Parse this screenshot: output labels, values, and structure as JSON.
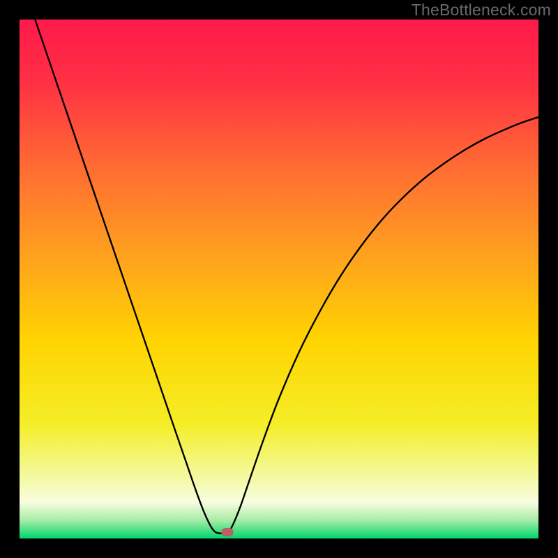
{
  "watermark": "TheBottleneck.com",
  "chart_data": {
    "type": "line",
    "title": "",
    "xlabel": "",
    "ylabel": "",
    "xlim": [
      0,
      1
    ],
    "ylim": [
      0,
      1
    ],
    "background_gradient": {
      "stops": [
        {
          "offset": 0.0,
          "color": "#ff1a4b"
        },
        {
          "offset": 0.12,
          "color": "#ff3044"
        },
        {
          "offset": 0.28,
          "color": "#ff6a33"
        },
        {
          "offset": 0.45,
          "color": "#ffa01f"
        },
        {
          "offset": 0.62,
          "color": "#ffd400"
        },
        {
          "offset": 0.78,
          "color": "#f5ee28"
        },
        {
          "offset": 0.88,
          "color": "#f4f9a0"
        },
        {
          "offset": 0.93,
          "color": "#f8fde0"
        },
        {
          "offset": 0.965,
          "color": "#a6eca6"
        },
        {
          "offset": 1.0,
          "color": "#00d66b"
        }
      ]
    },
    "series": [
      {
        "name": "curve",
        "stroke": "#000000",
        "stroke_width": 2.4,
        "points": [
          {
            "x": 0.03,
            "y": 1.0
          },
          {
            "x": 0.06,
            "y": 0.912
          },
          {
            "x": 0.09,
            "y": 0.824
          },
          {
            "x": 0.12,
            "y": 0.736
          },
          {
            "x": 0.15,
            "y": 0.648
          },
          {
            "x": 0.18,
            "y": 0.56
          },
          {
            "x": 0.21,
            "y": 0.472
          },
          {
            "x": 0.24,
            "y": 0.384
          },
          {
            "x": 0.27,
            "y": 0.296
          },
          {
            "x": 0.3,
            "y": 0.208
          },
          {
            "x": 0.32,
            "y": 0.15
          },
          {
            "x": 0.34,
            "y": 0.092
          },
          {
            "x": 0.355,
            "y": 0.052
          },
          {
            "x": 0.365,
            "y": 0.03
          },
          {
            "x": 0.372,
            "y": 0.018
          },
          {
            "x": 0.378,
            "y": 0.012
          },
          {
            "x": 0.385,
            "y": 0.01
          },
          {
            "x": 0.395,
            "y": 0.01
          },
          {
            "x": 0.402,
            "y": 0.012
          },
          {
            "x": 0.41,
            "y": 0.024
          },
          {
            "x": 0.425,
            "y": 0.06
          },
          {
            "x": 0.445,
            "y": 0.118
          },
          {
            "x": 0.47,
            "y": 0.19
          },
          {
            "x": 0.5,
            "y": 0.27
          },
          {
            "x": 0.54,
            "y": 0.362
          },
          {
            "x": 0.58,
            "y": 0.44
          },
          {
            "x": 0.62,
            "y": 0.508
          },
          {
            "x": 0.66,
            "y": 0.566
          },
          {
            "x": 0.7,
            "y": 0.616
          },
          {
            "x": 0.74,
            "y": 0.658
          },
          {
            "x": 0.78,
            "y": 0.694
          },
          {
            "x": 0.82,
            "y": 0.724
          },
          {
            "x": 0.86,
            "y": 0.75
          },
          {
            "x": 0.9,
            "y": 0.772
          },
          {
            "x": 0.94,
            "y": 0.79
          },
          {
            "x": 0.97,
            "y": 0.802
          },
          {
            "x": 1.0,
            "y": 0.812
          }
        ]
      }
    ],
    "marker": {
      "x": 0.4,
      "y": 0.012,
      "color": "#b76160"
    }
  }
}
